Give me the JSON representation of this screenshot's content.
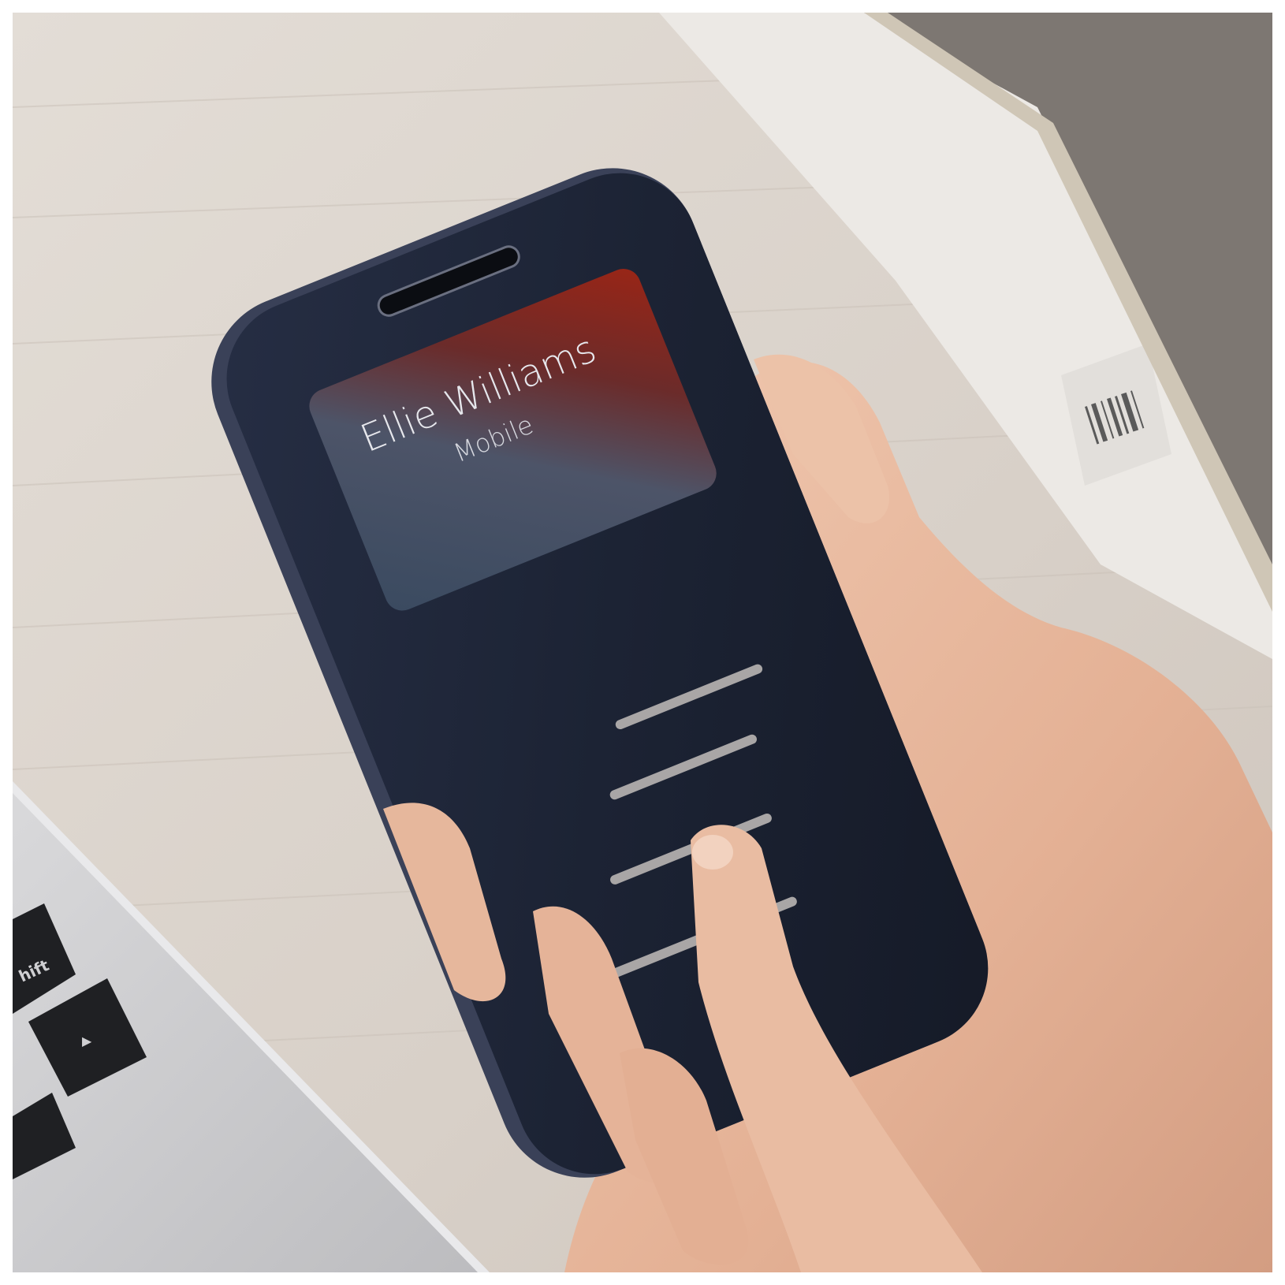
{
  "scene": {
    "subject": "phone-in-window-flip-case",
    "colors": {
      "desk": "#d9d2cb",
      "desk_grain": "#cfc7bf",
      "case_navy": "#1d2436",
      "case_edge": "#3a4158",
      "laptop_body": "#cfcfd1",
      "key_black": "#1e1f22",
      "skin": "#e7b9a0",
      "skin_shadow": "#c98e75",
      "paper": "#ebe8e4",
      "notebook": "#7a746f",
      "window_gradient_start": "#3b4c62",
      "window_gradient_end": "#8c2318",
      "sensor_strip": "#a9a6a6"
    }
  },
  "caller_window": {
    "name": "Ellie Williams",
    "label": "Mobile"
  },
  "keyboard": {
    "shift_fragment": "hift",
    "arrow_glyph": "▶"
  }
}
